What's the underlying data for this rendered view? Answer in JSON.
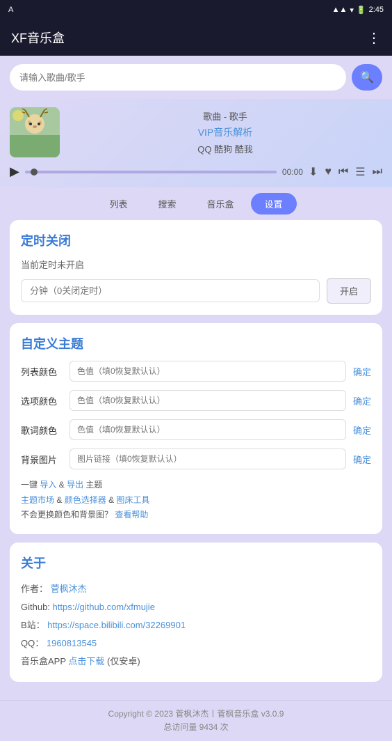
{
  "statusBar": {
    "appLabel": "A",
    "time": "2:45",
    "battery": "🔋"
  },
  "header": {
    "title": "XF音乐盒",
    "moreLabel": "⋮"
  },
  "search": {
    "placeholder": "请输入歌曲/歌手",
    "searchIconLabel": "🔍"
  },
  "player": {
    "songInfo": "歌曲 - 歌手",
    "vipLabel": "VIP音乐解析",
    "platforms": "QQ 酷狗 酷我",
    "timeDisplay": "00:00"
  },
  "tabs": [
    {
      "label": "列表",
      "active": false
    },
    {
      "label": "搜索",
      "active": false
    },
    {
      "label": "音乐盒",
      "active": false
    },
    {
      "label": "设置",
      "active": true
    }
  ],
  "timerSection": {
    "title": "定时关闭",
    "statusText": "当前定时未开启",
    "inputPlaceholder": "分钟（0关闭定时）",
    "enableLabel": "开启"
  },
  "themeSection": {
    "title": "自定义主题",
    "rows": [
      {
        "label": "列表颜色",
        "placeholder": "色值（填0恢复默认认）",
        "confirm": "确定"
      },
      {
        "label": "选项颜色",
        "placeholder": "色值（填0恢复默认认）",
        "confirm": "确定"
      },
      {
        "label": "歌词颜色",
        "placeholder": "色值（填0恢复默认认）",
        "confirm": "确定"
      },
      {
        "label": "背景图片",
        "placeholder": "图片链接（填0恢复默认认）",
        "confirm": "确定"
      }
    ],
    "actionText": "一键 导入&导出主题",
    "actionImport": "导入",
    "actionExport": "导出",
    "marketLabel": "主题市场",
    "colorPickerLabel": "颜色选择器",
    "bedToolLabel": "图床工具",
    "helpText": "不会更换颜色和背景图？",
    "helpLink": "查看帮助"
  },
  "aboutSection": {
    "title": "关于",
    "authorLabel": "作者：",
    "authorName": "菅枫沐杰",
    "githubLabel": "Github: ",
    "githubUrl": "https://github.com/xfmujie",
    "biliLabel": "B站：",
    "biliUrl": "https://space.bilibili.com/32269901",
    "qqLabel": "QQ：",
    "qqNumber": "1960813545",
    "appLabel": "音乐盒APP",
    "downloadLabel": "点击下载",
    "downloadNote": "(仅安卓)"
  },
  "footer": {
    "copyright": "Copyright © 2023 菅枫沐杰丨菅枫音乐盒 v3.0.9",
    "visits": "总访问量 9434 次"
  }
}
